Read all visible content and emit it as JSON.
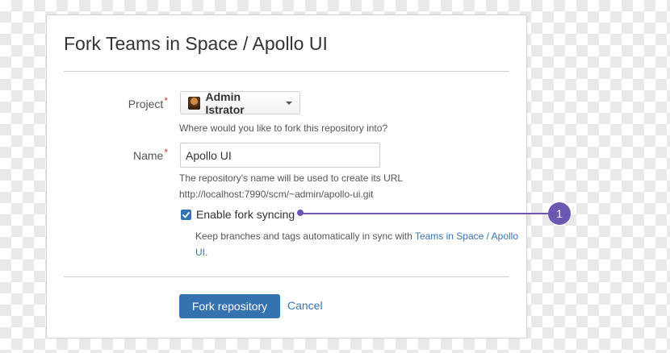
{
  "dialog": {
    "title": "Fork Teams in Space / Apollo UI"
  },
  "form": {
    "project": {
      "label": "Project",
      "required_mark": "*",
      "selected": "Admin Istrator",
      "help": "Where would you like to fork this repository into?"
    },
    "name": {
      "label": "Name",
      "required_mark": "*",
      "value": "Apollo UI",
      "help_line1": "The repository's name will be used to create its URL",
      "help_line2": "http://localhost:7990/scm/~admin/apollo-ui.git"
    },
    "fork_sync": {
      "checked": true,
      "label": "Enable fork syncing",
      "help_prefix": "Keep branches and tags automatically in sync with ",
      "help_link": "Teams in Space / Apollo UI",
      "help_suffix": "."
    }
  },
  "actions": {
    "fork_label": "Fork repository",
    "cancel_label": "Cancel"
  },
  "callout": {
    "number": "1"
  },
  "colors": {
    "primary": "#3572b0",
    "link": "#3b73af",
    "required": "#d04437",
    "callout": "#6c57b3"
  }
}
